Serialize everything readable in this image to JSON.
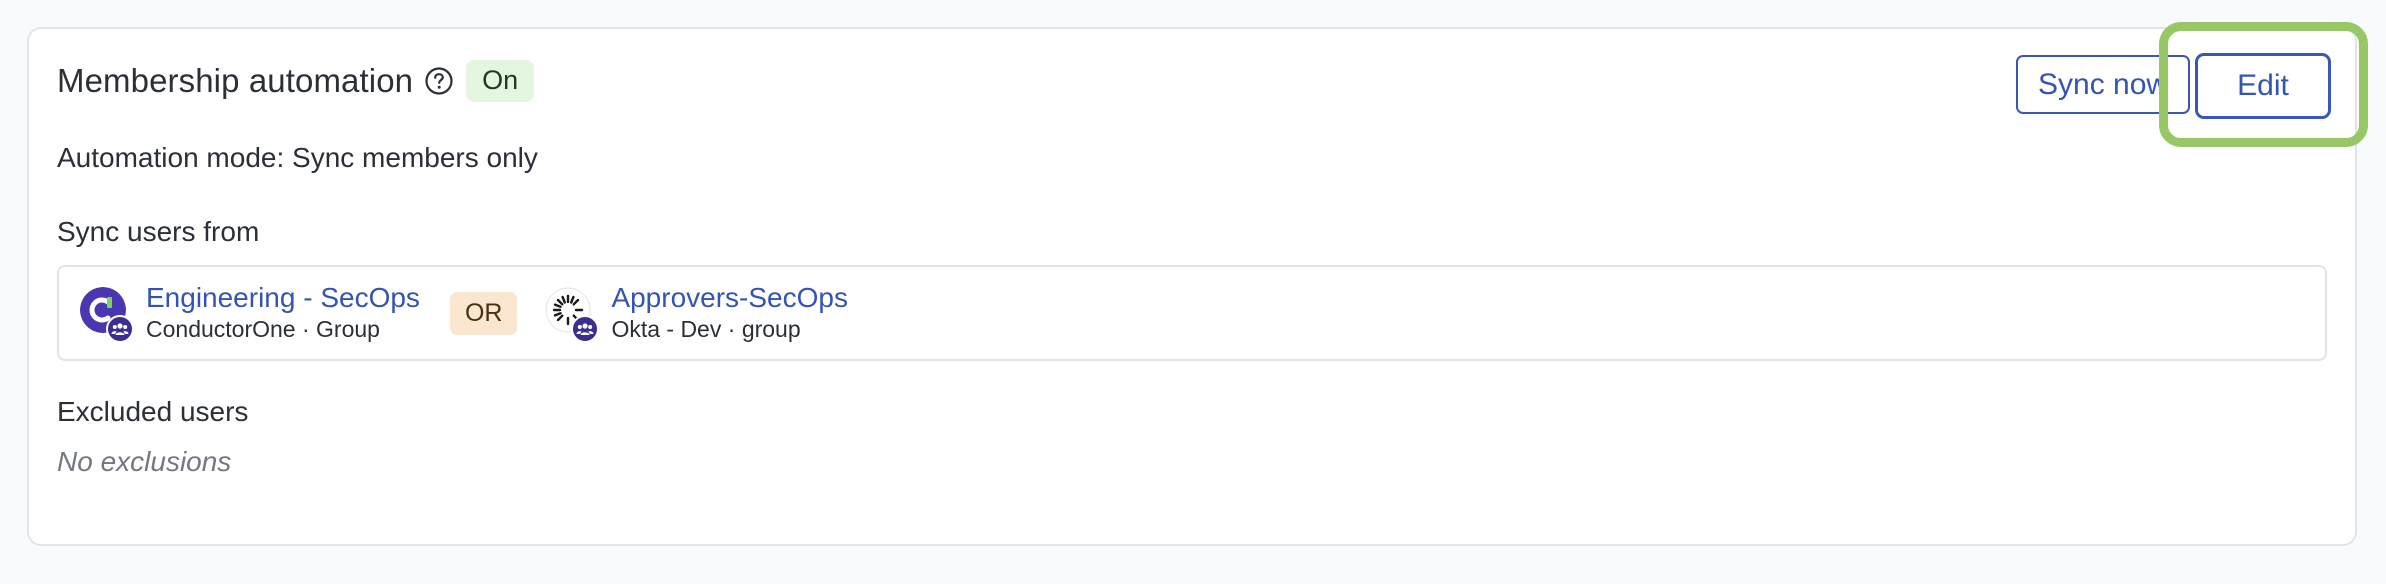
{
  "header": {
    "title": "Membership automation",
    "help_icon": "help-circle-icon",
    "status_badge": "On"
  },
  "actions": {
    "sync_label": "Sync now",
    "edit_label": "Edit"
  },
  "mode": {
    "label": "Automation mode:",
    "value": "Sync members only"
  },
  "sync_users": {
    "label": "Sync users from",
    "connector": "OR",
    "sources": [
      {
        "name": "Engineering - SecOps",
        "app": "ConductorOne",
        "separator": "·",
        "type": "Group",
        "icon": "conductorone-logo-icon"
      },
      {
        "name": "Approvers-SecOps",
        "app": "Okta - Dev",
        "separator": "·",
        "type": "group",
        "icon": "okta-logo-icon"
      }
    ]
  },
  "excluded": {
    "label": "Excluded users",
    "empty_text": "No exclusions"
  },
  "colors": {
    "accent": "#3454b4",
    "on_badge_bg": "#e4f5e0",
    "or_badge_bg": "#fbe6cf",
    "highlight": "#98c765"
  }
}
